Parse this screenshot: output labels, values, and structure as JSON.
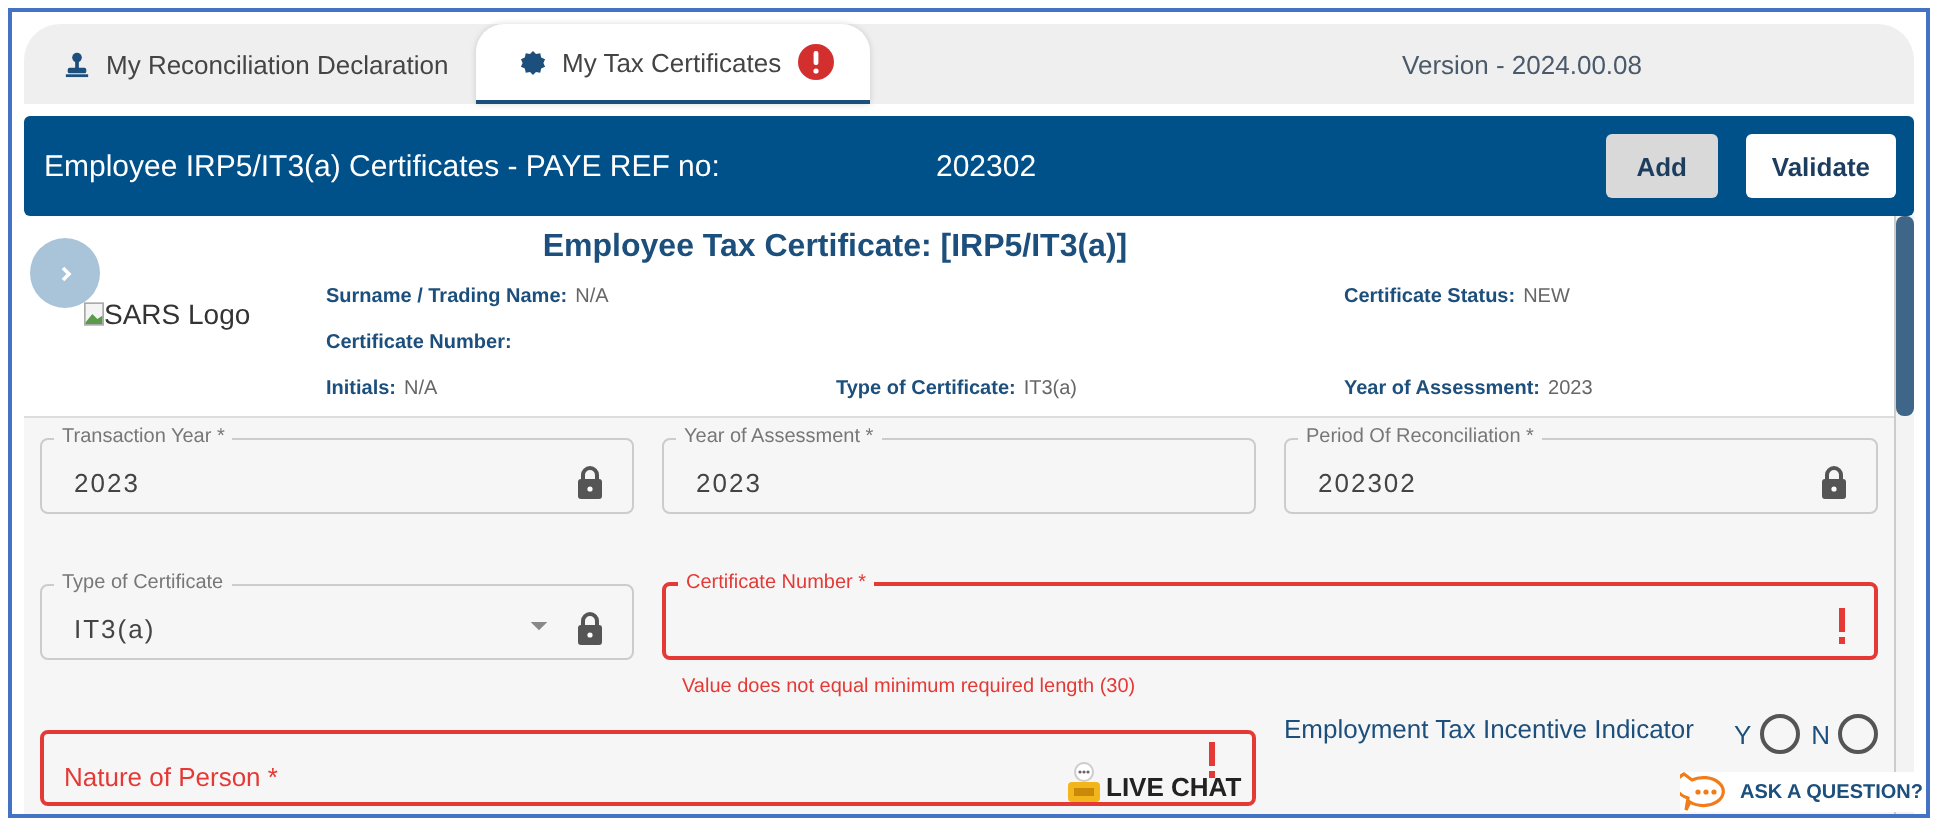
{
  "tabs": [
    {
      "label": "My Reconciliation Declaration",
      "selected": false,
      "alert": false
    },
    {
      "label": "My Tax Certificates",
      "selected": true,
      "alert": true
    }
  ],
  "version": "Version - 2024.00.08",
  "header": {
    "title": "Employee IRP5/IT3(a) Certificates - PAYE REF no:",
    "ref": "202302",
    "buttons": [
      {
        "label": "Add",
        "kind": "secondary"
      },
      {
        "label": "Validate",
        "kind": "primary"
      }
    ]
  },
  "certificate": {
    "logo_alt": "SARS Logo",
    "title": "Employee Tax Certificate: [IRP5/IT3(a)]",
    "info_rows": [
      [
        {
          "label": "Surname / Trading Name:",
          "value": "N/A"
        },
        null,
        {
          "label": "Certificate Status:",
          "value": "NEW"
        }
      ],
      [
        {
          "label": "Certificate Number:"
        },
        null,
        null
      ],
      [
        {
          "label": "Initials:",
          "value": "N/A"
        },
        {
          "label": "Type of Certificate:",
          "value": "IT3(a)"
        },
        {
          "label": "Year of Assessment:",
          "value": "2023"
        }
      ]
    ]
  },
  "fields": [
    {
      "label": "Transaction Year *",
      "value": "2023",
      "kind": "text",
      "locked": true,
      "error": false
    },
    {
      "label": "Year of Assessment *",
      "value": "2023",
      "kind": "text",
      "locked": false,
      "error": false
    },
    {
      "label": "Period Of Reconciliation *",
      "value": "202302",
      "kind": "text",
      "locked": true,
      "error": false
    },
    {
      "label": "Type of Certificate",
      "value": "IT3(a)",
      "kind": "select",
      "locked": true,
      "error": false
    },
    {
      "label": "Certificate Number *",
      "kind": "text",
      "locked": false,
      "error": true,
      "message": "Value does not equal minimum required length (30)"
    }
  ],
  "nature_field": {
    "label": "Nature of Person *",
    "error": true
  },
  "indicator": {
    "label": "Employment Tax Incentive Indicator",
    "options": [
      {
        "label": "Y",
        "selected": false
      },
      {
        "label": "N",
        "selected": false
      }
    ]
  },
  "live_chat": "LIVE CHAT",
  "ask": "ASK A QUESTION?"
}
